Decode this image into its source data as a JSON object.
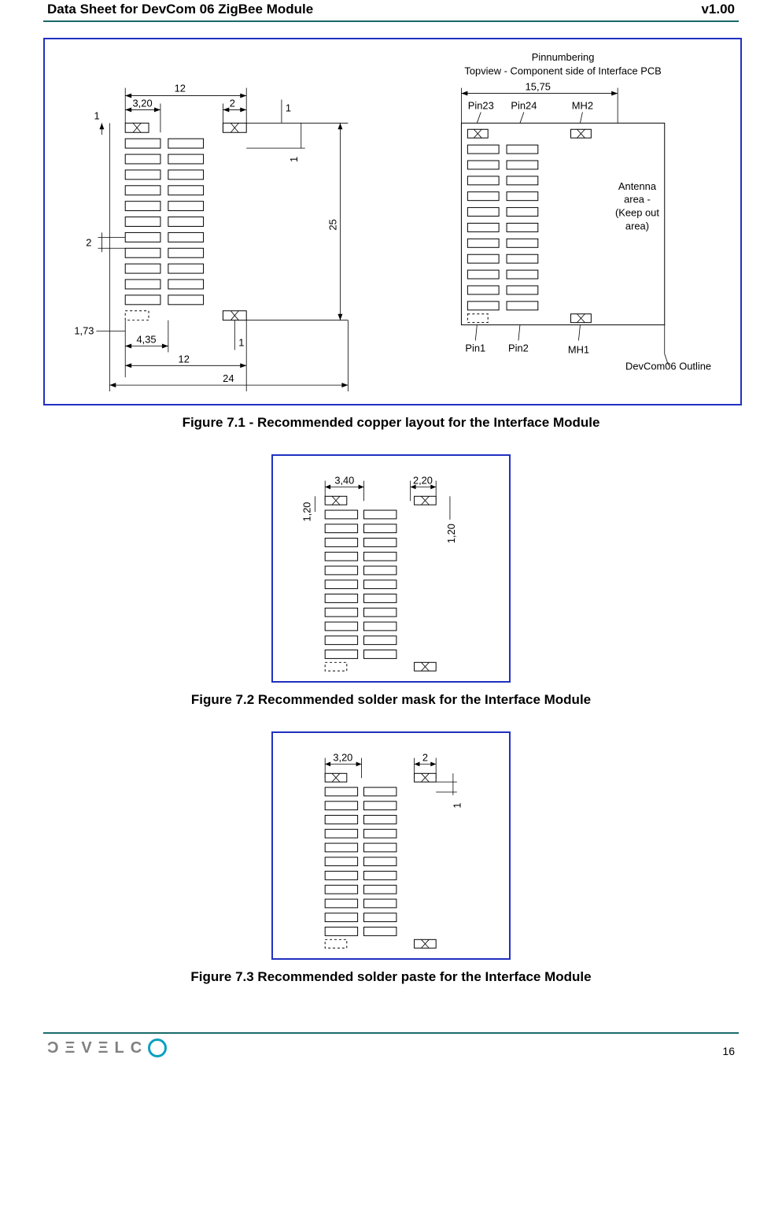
{
  "header": {
    "title": "Data Sheet for DevCom 06 ZigBee Module",
    "version_prefix": "v",
    "version": "1.00"
  },
  "figures": {
    "fig1": {
      "caption": "Figure 7.1 - Recommended copper layout for the Interface Module",
      "dims": {
        "top_outer": "12",
        "top_inner_left": "3,20",
        "top_inner_right": "2",
        "top_right_tick": "1",
        "left_top_tick": "1",
        "left_mid_tick": "2",
        "right_tick": "1",
        "height": "25",
        "bottom_inner_left": "4,35",
        "bottom_inner_tick": "1",
        "bottom_left_label": "1,73",
        "bottom_mid": "12",
        "bottom_outer": "24"
      },
      "pin_title1": "Pinnumbering",
      "pin_title2": "Topview - Component side of Interface PCB",
      "pin_top_dim": "15,75",
      "labels": {
        "pin23": "Pin23",
        "pin24": "Pin24",
        "mh2": "MH2",
        "pin1": "Pin1",
        "pin2": "Pin2",
        "mh1": "MH1",
        "antenna1": "Antenna",
        "antenna2": "area -",
        "antenna3": "(Keep out",
        "antenna4": "area)",
        "outline": "DevCom06 Outline"
      }
    },
    "fig2": {
      "caption": "Figure 7.2 Recommended solder mask for the Interface Module",
      "dims": {
        "top_left": "3,40",
        "top_right": "2,20",
        "left": "1,20",
        "right": "1,20"
      }
    },
    "fig3": {
      "caption": "Figure 7.3 Recommended solder paste for the Interface Module",
      "dims": {
        "top_left": "3,20",
        "top_right": "2",
        "right": "1"
      }
    }
  },
  "footer": {
    "page": "16"
  }
}
